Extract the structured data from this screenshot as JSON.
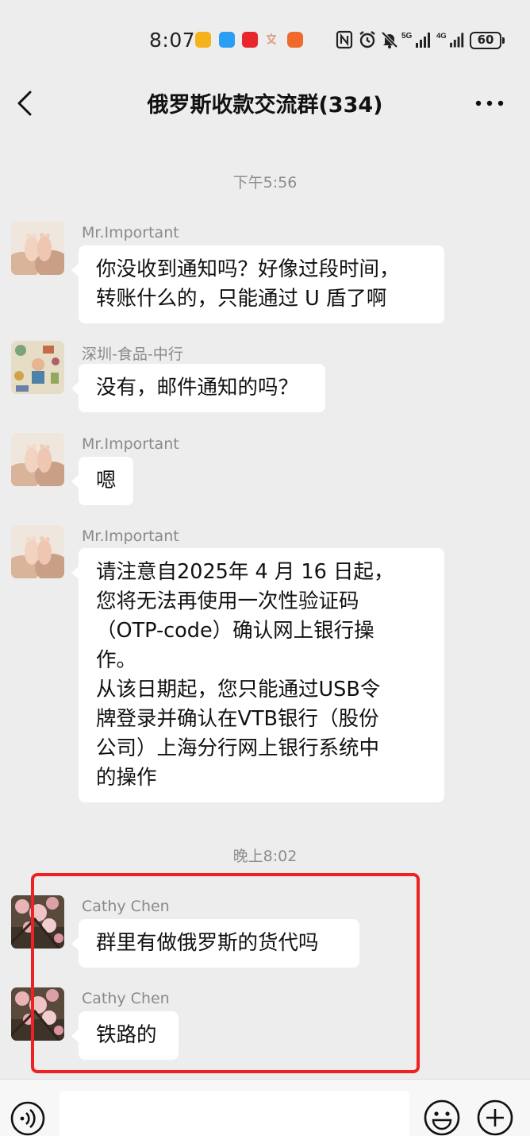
{
  "status_bar": {
    "time": "8:07",
    "network_5g": "5G",
    "network_4g": "4G",
    "battery": "60",
    "icons": [
      "mail-app-icon",
      "bird-app-icon",
      "red-app-icon",
      "translate-icon",
      "app-badge-icon",
      "nfc-icon",
      "alarm-icon",
      "mute-icon",
      "signal-5g-icon",
      "signal-4g-icon",
      "battery-icon"
    ]
  },
  "header": {
    "title": "俄罗斯收款交流群(334)",
    "back_icon": "chevron-left-icon",
    "more_icon": "more-dots-icon"
  },
  "chat": {
    "timestamp_1": "下午5:56",
    "timestamp_2": "晚上8:02",
    "messages": [
      {
        "sender": "Mr.Important",
        "avatar": "baby-feet-avatar",
        "lines": [
          "你没收到通知吗？好像过段时间，",
          "转账什么的，只能通过 U 盾了啊"
        ]
      },
      {
        "sender": "深圳-食品-中行",
        "avatar": "doodle-avatar",
        "lines": [
          "没有，邮件通知的吗？"
        ]
      },
      {
        "sender": "Mr.Important",
        "avatar": "baby-feet-avatar",
        "lines": [
          "嗯"
        ]
      },
      {
        "sender": "Mr.Important",
        "avatar": "baby-feet-avatar",
        "lines": [
          "请注意自2025年 4 月 16 日起，",
          "您将无法再使用一次性验证码",
          "（OTP-code）确认网上银行操",
          "作。",
          "从该日期起，您只能通过USB令",
          "牌登录并确认在VTB银行（股份",
          "公司）上海分行网上银行系统中",
          "的操作"
        ]
      },
      {
        "sender": "Cathy Chen",
        "avatar": "blossom-avatar",
        "lines": [
          "群里有做俄罗斯的货代吗"
        ]
      },
      {
        "sender": "Cathy Chen",
        "avatar": "blossom-avatar",
        "lines": [
          "铁路的"
        ]
      }
    ]
  },
  "input_bar": {
    "voice_icon": "voice-icon",
    "emoji_icon": "emoji-icon",
    "add_icon": "plus-circle-icon",
    "input_value": ""
  },
  "colors": {
    "background": "#ededed",
    "bubble": "#ffffff",
    "highlight": "#ee2222"
  }
}
